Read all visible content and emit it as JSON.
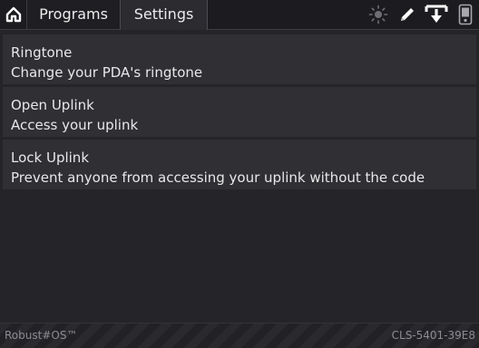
{
  "header": {
    "tabs": [
      {
        "label": "Programs",
        "active": false
      },
      {
        "label": "Settings",
        "active": true
      }
    ],
    "icons": [
      "home-icon",
      "brightness-icon",
      "pen-icon",
      "download-icon",
      "pda-icon"
    ]
  },
  "settings": {
    "items": [
      {
        "title": "Ringtone",
        "description": "Change your PDA's ringtone"
      },
      {
        "title": "Open Uplink",
        "description": "Access your uplink"
      },
      {
        "title": "Lock Uplink",
        "description": "Prevent anyone from accessing your uplink without the code"
      }
    ]
  },
  "footer": {
    "brand": "Robust#OS™",
    "serial": "CLS-5401-39E8"
  },
  "colors": {
    "background": "#25252a",
    "item_background": "#2f2f34",
    "topbar": "#1c1c20",
    "footer_text": "#8b8b93"
  }
}
